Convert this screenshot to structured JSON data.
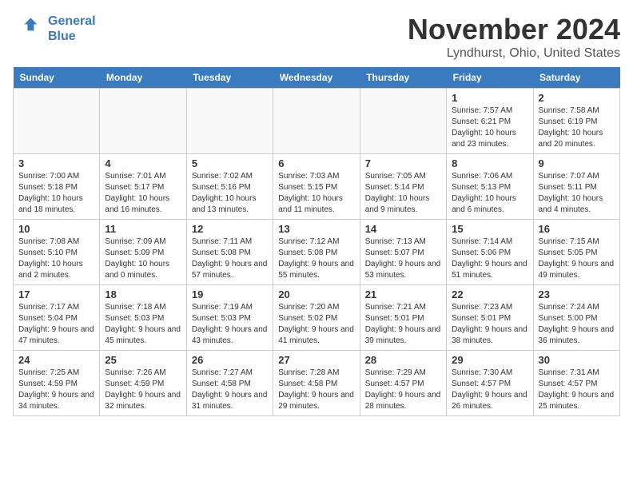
{
  "header": {
    "logo_line1": "General",
    "logo_line2": "Blue",
    "month": "November 2024",
    "location": "Lyndhurst, Ohio, United States"
  },
  "weekdays": [
    "Sunday",
    "Monday",
    "Tuesday",
    "Wednesday",
    "Thursday",
    "Friday",
    "Saturday"
  ],
  "weeks": [
    [
      {
        "day": "",
        "info": ""
      },
      {
        "day": "",
        "info": ""
      },
      {
        "day": "",
        "info": ""
      },
      {
        "day": "",
        "info": ""
      },
      {
        "day": "",
        "info": ""
      },
      {
        "day": "1",
        "info": "Sunrise: 7:57 AM\nSunset: 6:21 PM\nDaylight: 10 hours and 23 minutes."
      },
      {
        "day": "2",
        "info": "Sunrise: 7:58 AM\nSunset: 6:19 PM\nDaylight: 10 hours and 20 minutes."
      }
    ],
    [
      {
        "day": "3",
        "info": "Sunrise: 7:00 AM\nSunset: 5:18 PM\nDaylight: 10 hours and 18 minutes."
      },
      {
        "day": "4",
        "info": "Sunrise: 7:01 AM\nSunset: 5:17 PM\nDaylight: 10 hours and 16 minutes."
      },
      {
        "day": "5",
        "info": "Sunrise: 7:02 AM\nSunset: 5:16 PM\nDaylight: 10 hours and 13 minutes."
      },
      {
        "day": "6",
        "info": "Sunrise: 7:03 AM\nSunset: 5:15 PM\nDaylight: 10 hours and 11 minutes."
      },
      {
        "day": "7",
        "info": "Sunrise: 7:05 AM\nSunset: 5:14 PM\nDaylight: 10 hours and 9 minutes."
      },
      {
        "day": "8",
        "info": "Sunrise: 7:06 AM\nSunset: 5:13 PM\nDaylight: 10 hours and 6 minutes."
      },
      {
        "day": "9",
        "info": "Sunrise: 7:07 AM\nSunset: 5:11 PM\nDaylight: 10 hours and 4 minutes."
      }
    ],
    [
      {
        "day": "10",
        "info": "Sunrise: 7:08 AM\nSunset: 5:10 PM\nDaylight: 10 hours and 2 minutes."
      },
      {
        "day": "11",
        "info": "Sunrise: 7:09 AM\nSunset: 5:09 PM\nDaylight: 10 hours and 0 minutes."
      },
      {
        "day": "12",
        "info": "Sunrise: 7:11 AM\nSunset: 5:08 PM\nDaylight: 9 hours and 57 minutes."
      },
      {
        "day": "13",
        "info": "Sunrise: 7:12 AM\nSunset: 5:08 PM\nDaylight: 9 hours and 55 minutes."
      },
      {
        "day": "14",
        "info": "Sunrise: 7:13 AM\nSunset: 5:07 PM\nDaylight: 9 hours and 53 minutes."
      },
      {
        "day": "15",
        "info": "Sunrise: 7:14 AM\nSunset: 5:06 PM\nDaylight: 9 hours and 51 minutes."
      },
      {
        "day": "16",
        "info": "Sunrise: 7:15 AM\nSunset: 5:05 PM\nDaylight: 9 hours and 49 minutes."
      }
    ],
    [
      {
        "day": "17",
        "info": "Sunrise: 7:17 AM\nSunset: 5:04 PM\nDaylight: 9 hours and 47 minutes."
      },
      {
        "day": "18",
        "info": "Sunrise: 7:18 AM\nSunset: 5:03 PM\nDaylight: 9 hours and 45 minutes."
      },
      {
        "day": "19",
        "info": "Sunrise: 7:19 AM\nSunset: 5:03 PM\nDaylight: 9 hours and 43 minutes."
      },
      {
        "day": "20",
        "info": "Sunrise: 7:20 AM\nSunset: 5:02 PM\nDaylight: 9 hours and 41 minutes."
      },
      {
        "day": "21",
        "info": "Sunrise: 7:21 AM\nSunset: 5:01 PM\nDaylight: 9 hours and 39 minutes."
      },
      {
        "day": "22",
        "info": "Sunrise: 7:23 AM\nSunset: 5:01 PM\nDaylight: 9 hours and 38 minutes."
      },
      {
        "day": "23",
        "info": "Sunrise: 7:24 AM\nSunset: 5:00 PM\nDaylight: 9 hours and 36 minutes."
      }
    ],
    [
      {
        "day": "24",
        "info": "Sunrise: 7:25 AM\nSunset: 4:59 PM\nDaylight: 9 hours and 34 minutes."
      },
      {
        "day": "25",
        "info": "Sunrise: 7:26 AM\nSunset: 4:59 PM\nDaylight: 9 hours and 32 minutes."
      },
      {
        "day": "26",
        "info": "Sunrise: 7:27 AM\nSunset: 4:58 PM\nDaylight: 9 hours and 31 minutes."
      },
      {
        "day": "27",
        "info": "Sunrise: 7:28 AM\nSunset: 4:58 PM\nDaylight: 9 hours and 29 minutes."
      },
      {
        "day": "28",
        "info": "Sunrise: 7:29 AM\nSunset: 4:57 PM\nDaylight: 9 hours and 28 minutes."
      },
      {
        "day": "29",
        "info": "Sunrise: 7:30 AM\nSunset: 4:57 PM\nDaylight: 9 hours and 26 minutes."
      },
      {
        "day": "30",
        "info": "Sunrise: 7:31 AM\nSunset: 4:57 PM\nDaylight: 9 hours and 25 minutes."
      }
    ]
  ]
}
